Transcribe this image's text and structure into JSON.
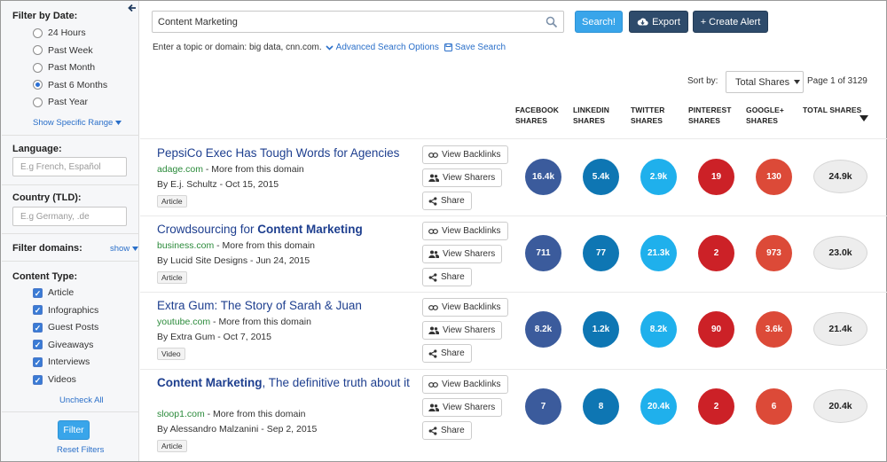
{
  "sidebar": {
    "date_title": "Filter by Date:",
    "date_options": [
      {
        "label": "24 Hours",
        "selected": false
      },
      {
        "label": "Past Week",
        "selected": false
      },
      {
        "label": "Past Month",
        "selected": false
      },
      {
        "label": "Past 6 Months",
        "selected": true
      },
      {
        "label": "Past Year",
        "selected": false
      }
    ],
    "show_range": "Show Specific Range",
    "language_title": "Language:",
    "language_placeholder": "E.g French, Español",
    "country_title": "Country (TLD):",
    "country_placeholder": "E.g Germany, .de",
    "domains_title": "Filter domains:",
    "domains_show": "show",
    "content_type_title": "Content Type:",
    "content_types": [
      {
        "label": "Article",
        "checked": true
      },
      {
        "label": "Infographics",
        "checked": true
      },
      {
        "label": "Guest Posts",
        "checked": true
      },
      {
        "label": "Giveaways",
        "checked": true
      },
      {
        "label": "Interviews",
        "checked": true
      },
      {
        "label": "Videos",
        "checked": true
      }
    ],
    "uncheck_all": "Uncheck All",
    "filter_label": "Filter",
    "reset_label": "Reset Filters"
  },
  "search": {
    "value": "Content Marketing",
    "search_label": "Search!",
    "export_label": "Export",
    "alert_label": "+ Create Alert",
    "hint_text": "Enter a topic or domain: big data, cnn.com.",
    "advanced_label": "Advanced Search Options",
    "save_label": "Save Search"
  },
  "sort": {
    "label": "Sort by:",
    "value": "Total Shares",
    "page_info": "Page 1 of 3129"
  },
  "columns": {
    "facebook": [
      "FACEBOOK",
      "SHARES"
    ],
    "linkedin": [
      "LINKEDIN",
      "SHARES"
    ],
    "twitter": [
      "TWITTER",
      "SHARES"
    ],
    "pinterest": [
      "PINTEREST",
      "SHARES"
    ],
    "googleplus": [
      "GOOGLE+",
      "SHARES"
    ],
    "total": [
      "TOTAL SHARES"
    ]
  },
  "actions": {
    "backlinks": "View Backlinks",
    "sharers": "View Sharers",
    "share": "Share"
  },
  "colors": {
    "facebook": "#3b5b9c",
    "linkedin": "#0e76b3",
    "twitter": "#1fb0ec",
    "pinterest": "#cc2127",
    "googleplus": "#dc4a38",
    "accent": "#39a5ea",
    "dark_button": "#2e4b6b"
  },
  "results": [
    {
      "title_pre": "PepsiCo Exec Has Tough Words for Agencies",
      "title_bold": "",
      "title_post": "",
      "domain": "adage.com",
      "more": " - More from this domain",
      "author_line": "By E.j. Schultz - Oct 15, 2015",
      "tag": "Article",
      "facebook": "16.4k",
      "linkedin": "5.4k",
      "twitter": "2.9k",
      "pinterest": "19",
      "googleplus": "130",
      "total": "24.9k"
    },
    {
      "title_pre": "Crowdsourcing for ",
      "title_bold": "Content Marketing",
      "title_post": "",
      "domain": "business.com",
      "more": " - More from this domain",
      "author_line": "By Lucid Site Designs - Jun 24, 2015",
      "tag": "Article",
      "facebook": "711",
      "linkedin": "77",
      "twitter": "21.3k",
      "pinterest": "2",
      "googleplus": "973",
      "total": "23.0k"
    },
    {
      "title_pre": "Extra Gum: The Story of Sarah & Juan",
      "title_bold": "",
      "title_post": "",
      "domain": "youtube.com",
      "more": " - More from this domain",
      "author_line": "By Extra Gum - Oct 7, 2015",
      "tag": "Video",
      "facebook": "8.2k",
      "linkedin": "1.2k",
      "twitter": "8.2k",
      "pinterest": "90",
      "googleplus": "3.6k",
      "total": "21.4k"
    },
    {
      "title_pre": "",
      "title_bold": "Content Marketing",
      "title_post": ", The definitive truth about it",
      "domain": "sloop1.com",
      "more": " - More from this domain",
      "author_line": "By Alessandro Malzanini - Sep 2, 2015",
      "tag": "Article",
      "facebook": "7",
      "linkedin": "8",
      "twitter": "20.4k",
      "pinterest": "2",
      "googleplus": "6",
      "total": "20.4k"
    }
  ]
}
